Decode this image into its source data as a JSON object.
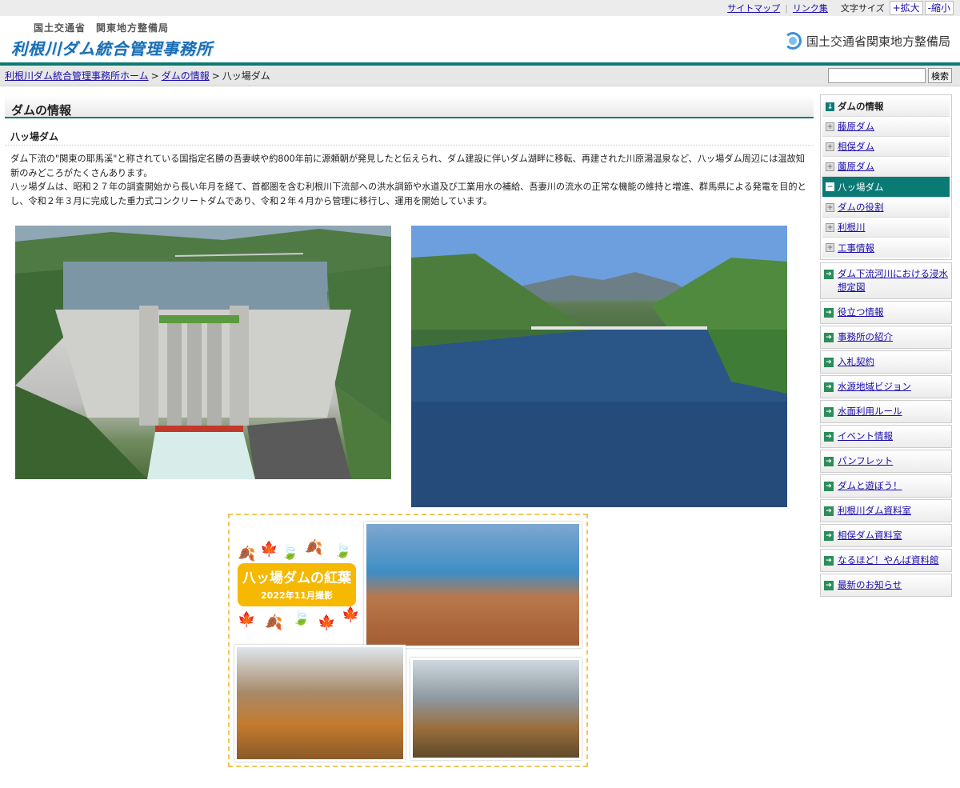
{
  "utility": {
    "sitemap": "サイトマップ",
    "links": "リンク集",
    "font_size_label": "文字サイズ",
    "enlarge": "+拡大",
    "shrink": "-縮小"
  },
  "header": {
    "org_small": "国土交通省　関東地方整備局",
    "office_title": "利根川ダム統合管理事務所",
    "mlit_name": "国土交通省関東地方整備局"
  },
  "breadcrumb": {
    "home": "利根川ダム統合管理事務所ホーム",
    "dam_info": "ダムの情報",
    "current": "八ッ場ダム",
    "separator": ">"
  },
  "search": {
    "placeholder": "",
    "button": "検索"
  },
  "main": {
    "section_title": "ダムの情報",
    "sub_title": "八ッ場ダム",
    "paragraph1": "ダム下流の\"関東の耶馬溪\"と称されている国指定名勝の吾妻峡や約800年前に源頼朝が発見したと伝えられ、ダム建設に伴いダム湖畔に移転、再建された川原湯温泉など、八ッ場ダム周辺には温故知新のみどころがたくさんあります。",
    "paragraph2": "八ッ場ダムは、昭和２７年の調査開始から長い年月を経て、首都圏を含む利根川下流部への洪水調節や水道及び工業用水の補給、吾妻川の流水の正常な機能の維持と増進、群馬県による発電を目的とし、令和２年３月に完成した重力式コンクリートダムであり、令和２年４月から管理に移行し、運用を開始しています。",
    "autumn_title": "八ッ場ダムの紅葉",
    "autumn_caption": "2022年11月撮影"
  },
  "sidebar": {
    "subnav": [
      {
        "label": "ダムの情報",
        "type": "head"
      },
      {
        "label": "藤原ダム",
        "type": "link"
      },
      {
        "label": "相俣ダム",
        "type": "link"
      },
      {
        "label": "薗原ダム",
        "type": "link"
      },
      {
        "label": "八ッ場ダム",
        "type": "active"
      },
      {
        "label": "ダムの役割",
        "type": "link"
      },
      {
        "label": "利根川",
        "type": "link"
      },
      {
        "label": "工事情報",
        "type": "link"
      }
    ],
    "mainnav": [
      "ダム下流河川における浸水想定図",
      "役立つ情報",
      "事務所の紹介",
      "入札契約",
      "水源地域ビジョン",
      "水面利用ルール",
      "イベント情報",
      "パンフレット",
      "ダムと遊ぼう！",
      "利根川ダム資料室",
      "相俣ダム資料室",
      "なるほど！やんば資料館",
      "最新のお知らせ"
    ]
  },
  "colors": {
    "accent": "#0b7a75",
    "link": "#1a0dab"
  }
}
